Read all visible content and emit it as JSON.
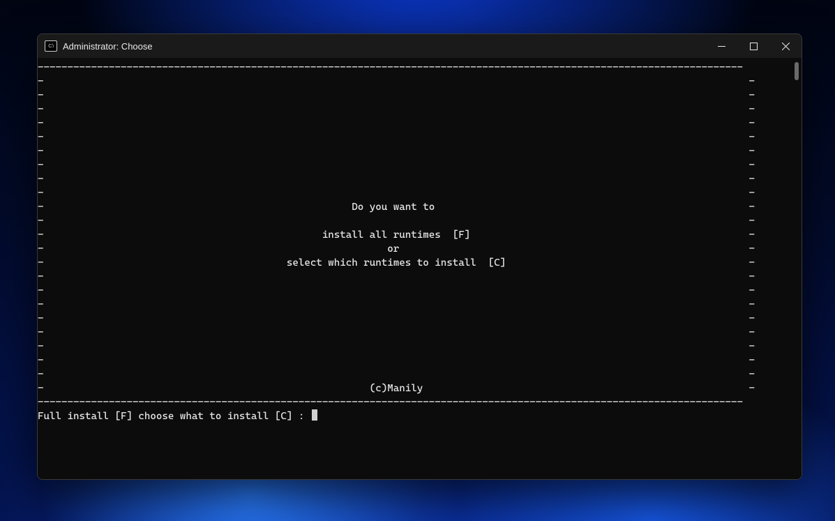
{
  "window": {
    "title": "Administrator:  Choose",
    "icon_label": "C:\\"
  },
  "box": {
    "top": "-----------------------------------------------------------------------------------------------------------------------",
    "side_l": "-",
    "side_r": "-",
    "bottom": "-----------------------------------------------------------------------------------------------------------------------",
    "msg_question": "Do you want to",
    "msg_opt_full": "install all runtimes  [F]",
    "msg_or": "or",
    "msg_opt_sel": "select which runtimes to install  [C]",
    "copyright": "(c)Manily"
  },
  "prompt": {
    "text": "Full install [F] choose what to install [C] :"
  }
}
